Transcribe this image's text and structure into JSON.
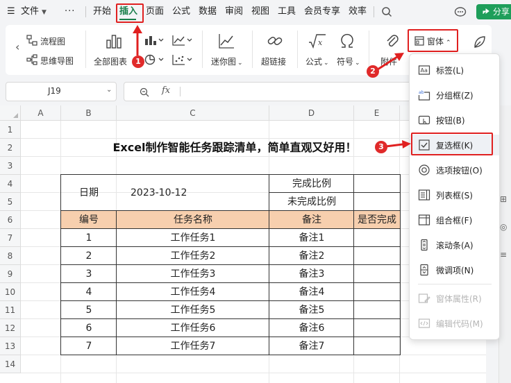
{
  "menubar": {
    "hamburger": "☰",
    "file_menu": "文件",
    "more": "···",
    "tabs": [
      "开始",
      "插入",
      "页面",
      "公式",
      "数据",
      "审阅",
      "视图",
      "工具",
      "会员专享",
      "效率"
    ],
    "share_label": "分享"
  },
  "ribbon": {
    "flowchart": "流程图",
    "mindmap": "思维导图",
    "all_charts": "全部图表",
    "sparkline": "迷你图",
    "hyperlink": "超链接",
    "formula": "公式",
    "symbol": "符号",
    "attachment": "附件",
    "form_controls": "窗体"
  },
  "formula_bar": {
    "cell_ref": "J19",
    "fx": "fx"
  },
  "sheet": {
    "columns": [
      "A",
      "B",
      "C",
      "D",
      "E"
    ],
    "rows": [
      "1",
      "2",
      "3",
      "4",
      "5",
      "6",
      "7",
      "8",
      "9",
      "10",
      "11",
      "12",
      "13",
      "14"
    ],
    "title": "Excel制作智能任务跟踪清单，简单直观又好用！",
    "date_label": "日期",
    "date_value": "2023-10-12",
    "done_ratio_label": "完成比例",
    "undone_ratio_label": "未完成比例",
    "headers": [
      "编号",
      "任务名称",
      "备注",
      "是否完成"
    ],
    "tasks": [
      {
        "id": "1",
        "name": "工作任务1",
        "note": "备注1"
      },
      {
        "id": "2",
        "name": "工作任务2",
        "note": "备注2"
      },
      {
        "id": "3",
        "name": "工作任务3",
        "note": "备注3"
      },
      {
        "id": "4",
        "name": "工作任务4",
        "note": "备注4"
      },
      {
        "id": "5",
        "name": "工作任务5",
        "note": "备注5"
      },
      {
        "id": "6",
        "name": "工作任务6",
        "note": "备注6"
      },
      {
        "id": "7",
        "name": "工作任务7",
        "note": "备注7"
      }
    ]
  },
  "dropdown": {
    "items": [
      {
        "label": "标签(L)",
        "icon": "label-icon",
        "enabled": true
      },
      {
        "label": "分组框(Z)",
        "icon": "groupbox-icon",
        "enabled": true
      },
      {
        "label": "按钮(B)",
        "icon": "button-icon",
        "enabled": true
      },
      {
        "label": "复选框(K)",
        "icon": "checkbox-icon",
        "enabled": true
      },
      {
        "label": "选项按钮(O)",
        "icon": "radio-icon",
        "enabled": true
      },
      {
        "label": "列表框(S)",
        "icon": "listbox-icon",
        "enabled": true
      },
      {
        "label": "组合框(F)",
        "icon": "combobox-icon",
        "enabled": true
      },
      {
        "label": "滚动条(A)",
        "icon": "scrollbar-icon",
        "enabled": true
      },
      {
        "label": "微调项(N)",
        "icon": "spinner-icon",
        "enabled": true
      },
      {
        "label": "窗体属性(R)",
        "icon": "properties-icon",
        "enabled": false
      },
      {
        "label": "编辑代码(M)",
        "icon": "code-icon",
        "enabled": false
      }
    ]
  },
  "annotations": {
    "step1": "1",
    "step2": "2",
    "step3": "3",
    "color": "#e02020"
  },
  "colors": {
    "accent_green": "#1a7f4b",
    "header_fill": "#f7cfae",
    "share_green": "#1e9e5a"
  }
}
